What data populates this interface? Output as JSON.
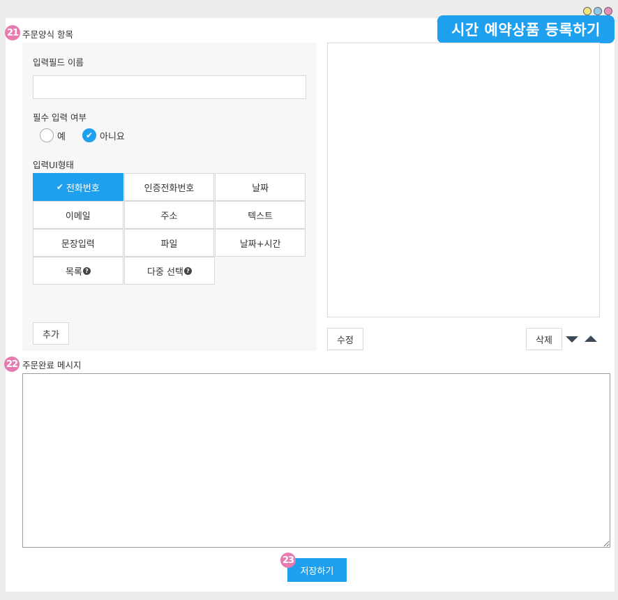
{
  "colors": {
    "accent": "#1fa0ee",
    "badge": "#e77bb0",
    "dot_yellow": "#f4e27a",
    "dot_blue": "#8ec9ea",
    "dot_pink": "#e98dbb"
  },
  "header": {
    "title": "시간 예약상품 등록하기"
  },
  "sections": {
    "order_form": {
      "num": "21",
      "label": "주문양식 항목"
    },
    "order_complete": {
      "num": "22",
      "label": "주문완료 메시지"
    },
    "save": {
      "num": "23"
    }
  },
  "form": {
    "field_name_label": "입력필드 이름",
    "field_name_value": "",
    "required_label": "필수 입력 여부",
    "required_options": [
      "예",
      "아니요"
    ],
    "required_selected": "아니요",
    "ui_type_label": "입력UI형태",
    "ui_types": [
      [
        "전화번호",
        "인증전화번호",
        "날짜"
      ],
      [
        "이메일",
        "주소",
        "텍스트"
      ],
      [
        "문장입력",
        "파일",
        "날짜+시간"
      ],
      [
        "목록",
        "다중 선택"
      ]
    ],
    "ui_type_selected": "전화번호",
    "help_icon": "question-circle-icon",
    "add_button": "추가"
  },
  "preview": {
    "edit_button": "수정",
    "delete_button": "삭제"
  },
  "message": {
    "value": ""
  },
  "save_button": "저장하기"
}
